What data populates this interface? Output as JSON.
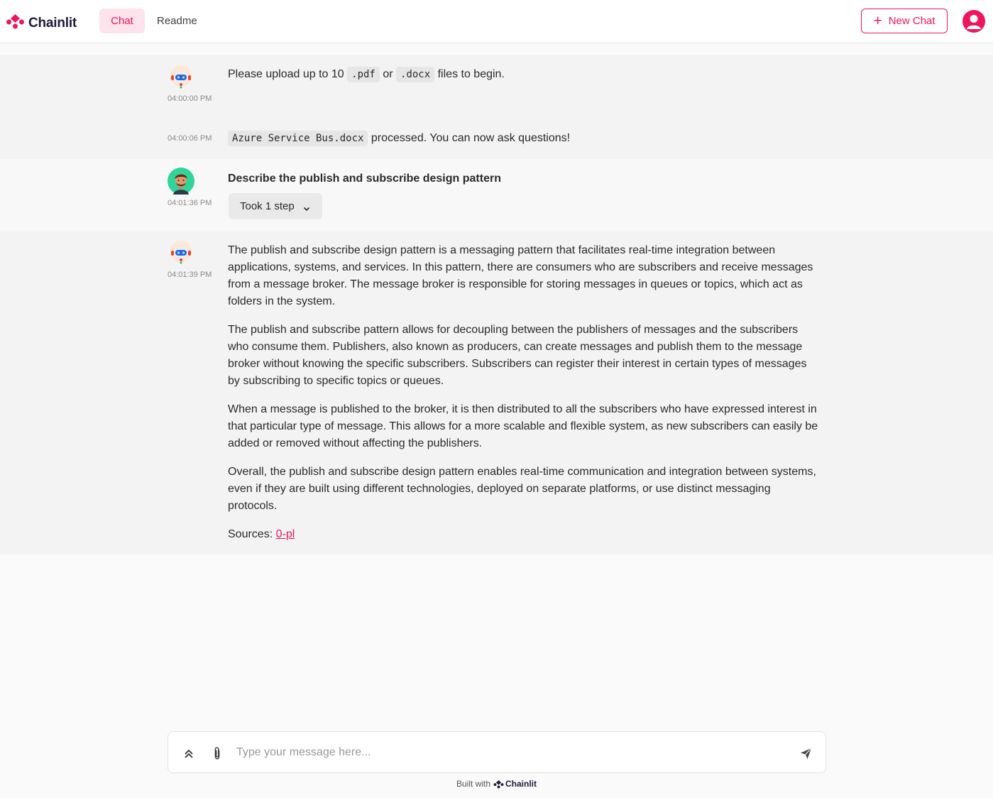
{
  "app": {
    "logo_text": "Chainlit",
    "logo_icon": "chainlit-logo-icon",
    "accent_color": "#f0135f"
  },
  "nav": {
    "tabs": [
      {
        "label": "Chat",
        "active": true
      },
      {
        "label": "Readme",
        "active": false
      }
    ],
    "new_chat_label": "New Chat",
    "user_icon": "user-avatar-icon"
  },
  "messages": [
    {
      "author": "assistant",
      "avatar": "robot-avatar-icon",
      "time": "04:00:00 PM",
      "parts": {
        "before": "Please upload up to 10",
        "code1": ".pdf",
        "mid": "or",
        "code2": ".docx",
        "after": "files to begin."
      }
    },
    {
      "author": "assistant",
      "time": "04:00:06 PM",
      "parts": {
        "code": "Azure Service Bus.docx",
        "after": "processed. You can now ask questions!"
      }
    },
    {
      "author": "user",
      "avatar": "user-face-avatar-icon",
      "time": "04:01:36 PM",
      "text": "Describe the publish and subscribe design pattern",
      "step_label": "Took 1 step"
    },
    {
      "author": "assistant",
      "avatar": "robot-avatar-icon",
      "time": "04:01:39 PM",
      "paragraphs": [
        "The publish and subscribe design pattern is a messaging pattern that facilitates real-time integration between applications, systems, and services. In this pattern, there are consumers who are subscribers and receive messages from a message broker. The message broker is responsible for storing messages in queues or topics, which act as folders in the system.",
        "The publish and subscribe pattern allows for decoupling between the publishers of messages and the subscribers who consume them. Publishers, also known as producers, can create messages and publish them to the message broker without knowing the specific subscribers. Subscribers can register their interest in certain types of messages by subscribing to specific topics or queues.",
        "When a message is published to the broker, it is then distributed to all the subscribers who have expressed interest in that particular type of message. This allows for a more scalable and flexible system, as new subscribers can easily be added or removed without affecting the publishers.",
        "Overall, the publish and subscribe design pattern enables real-time communication and integration between systems, even if they are built using different technologies, deployed on separate platforms, or use distinct messaging protocols."
      ],
      "sources_label": "Sources:",
      "source_link": "0-pl"
    }
  ],
  "composer": {
    "placeholder": "Type your message here...",
    "expand_icon": "chevrons-up-icon",
    "attach_icon": "paperclip-icon",
    "send_icon": "send-icon"
  },
  "footer": {
    "built_with": "Built with",
    "brand": "Chainlit"
  }
}
